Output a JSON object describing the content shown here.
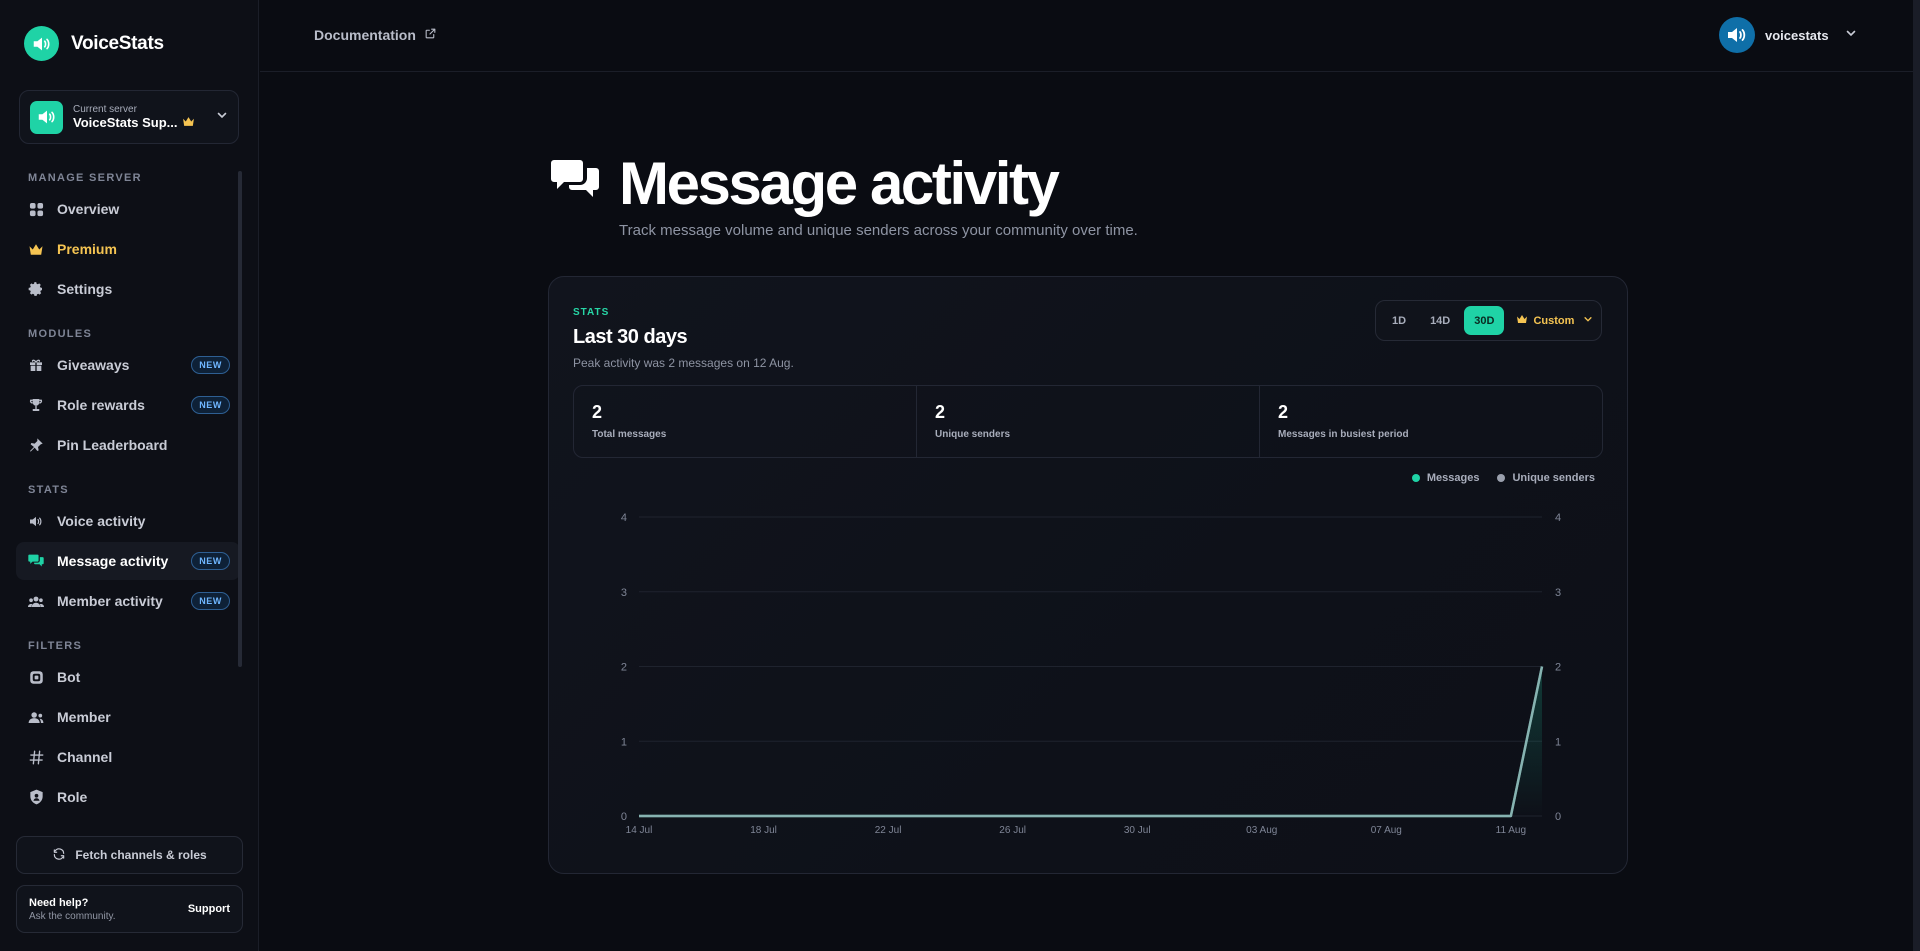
{
  "brand": {
    "name": "VoiceStats",
    "logo_icon": "speaker-icon"
  },
  "server": {
    "caption": "Current server",
    "name": "VoiceStats Sup...",
    "premium_icon": "crown-icon"
  },
  "nav": {
    "sections": [
      {
        "label": "MANAGE SERVER",
        "items": [
          {
            "label": "Overview",
            "icon": "grid-icon"
          },
          {
            "label": "Premium",
            "icon": "crown-icon",
            "premium": true
          },
          {
            "label": "Settings",
            "icon": "gear-icon"
          }
        ]
      },
      {
        "label": "MODULES",
        "items": [
          {
            "label": "Giveaways",
            "icon": "gift-icon",
            "badge": "NEW"
          },
          {
            "label": "Role rewards",
            "icon": "trophy-icon",
            "badge": "NEW"
          },
          {
            "label": "Pin Leaderboard",
            "icon": "pin-icon"
          }
        ]
      },
      {
        "label": "STATS",
        "items": [
          {
            "label": "Voice activity",
            "icon": "speaker-icon"
          },
          {
            "label": "Message activity",
            "icon": "chat-icon",
            "badge": "NEW",
            "active": true
          },
          {
            "label": "Member activity",
            "icon": "users-icon",
            "badge": "NEW"
          }
        ]
      },
      {
        "label": "FILTERS",
        "items": [
          {
            "label": "Bot",
            "icon": "bot-icon"
          },
          {
            "label": "Member",
            "icon": "user-icon"
          },
          {
            "label": "Channel",
            "icon": "hash-icon"
          },
          {
            "label": "Role",
            "icon": "shield-icon"
          }
        ]
      }
    ]
  },
  "sidebar_footer": {
    "fetch_label": "Fetch channels & roles",
    "help_title": "Need help?",
    "help_sub": "Ask the community.",
    "help_link": "Support"
  },
  "topbar": {
    "doc_label": "Documentation",
    "username": "voicestats"
  },
  "page": {
    "title": "Message activity",
    "description": "Track message volume and unique senders across your community over time."
  },
  "panel": {
    "tag": "STATS",
    "title": "Last 30 days",
    "subtitle": "Peak activity was 2 messages on 12 Aug.",
    "ranges": [
      {
        "label": "1D"
      },
      {
        "label": "14D"
      },
      {
        "label": "30D",
        "active": true
      },
      {
        "label": "Custom",
        "custom": true
      }
    ],
    "kpis": [
      {
        "value": "2",
        "label": "Total messages"
      },
      {
        "value": "2",
        "label": "Unique senders"
      },
      {
        "value": "2",
        "label": "Messages in busiest period"
      }
    ]
  },
  "colors": {
    "accent": "#1fd3a6",
    "premium": "#f5c452",
    "messages": "#1fd3a6",
    "senders": "#9aa0ad",
    "line": "#6fc9b6"
  },
  "chart_data": {
    "type": "line",
    "x": [
      "14 Jul",
      "15 Jul",
      "16 Jul",
      "17 Jul",
      "18 Jul",
      "19 Jul",
      "20 Jul",
      "21 Jul",
      "22 Jul",
      "23 Jul",
      "24 Jul",
      "25 Jul",
      "26 Jul",
      "27 Jul",
      "28 Jul",
      "29 Jul",
      "30 Jul",
      "31 Jul",
      "01 Aug",
      "02 Aug",
      "03 Aug",
      "04 Aug",
      "05 Aug",
      "06 Aug",
      "07 Aug",
      "08 Aug",
      "09 Aug",
      "10 Aug",
      "11 Aug",
      "12 Aug"
    ],
    "x_ticks": [
      "14 Jul",
      "18 Jul",
      "22 Jul",
      "26 Jul",
      "30 Jul",
      "03 Aug",
      "07 Aug",
      "11 Aug"
    ],
    "series": [
      {
        "name": "Messages",
        "values": [
          0,
          0,
          0,
          0,
          0,
          0,
          0,
          0,
          0,
          0,
          0,
          0,
          0,
          0,
          0,
          0,
          0,
          0,
          0,
          0,
          0,
          0,
          0,
          0,
          0,
          0,
          0,
          0,
          0,
          2
        ]
      },
      {
        "name": "Unique senders",
        "values": [
          0,
          0,
          0,
          0,
          0,
          0,
          0,
          0,
          0,
          0,
          0,
          0,
          0,
          0,
          0,
          0,
          0,
          0,
          0,
          0,
          0,
          0,
          0,
          0,
          0,
          0,
          0,
          0,
          0,
          2
        ]
      }
    ],
    "ylim": [
      0,
      4
    ],
    "y_ticks": [
      0,
      1,
      2,
      3,
      4
    ],
    "y2_ticks": [
      0,
      1,
      2,
      3,
      4
    ],
    "grid": true,
    "legend": "top-right"
  }
}
